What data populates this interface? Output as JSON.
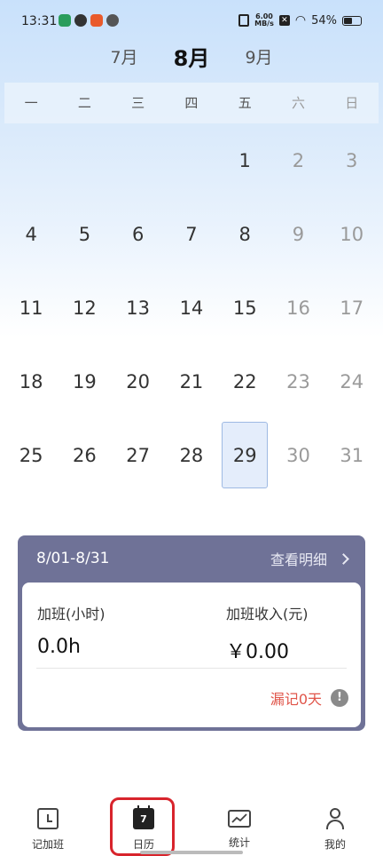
{
  "status_bar": {
    "time": "13:31",
    "net_speed_top": "6.00",
    "net_speed_bottom": "MB/s",
    "battery": "54%",
    "battery_level": 0.54
  },
  "months": {
    "prev": "7月",
    "current": "8月",
    "next": "9月"
  },
  "weekdays": [
    "一",
    "二",
    "三",
    "四",
    "五",
    "六",
    "日"
  ],
  "calendar": {
    "weeks": [
      [
        "",
        "",
        "",
        "",
        "1",
        "2",
        "3"
      ],
      [
        "4",
        "5",
        "6",
        "7",
        "8",
        "9",
        "10"
      ],
      [
        "11",
        "12",
        "13",
        "14",
        "15",
        "16",
        "17"
      ],
      [
        "18",
        "19",
        "20",
        "21",
        "22",
        "23",
        "24"
      ],
      [
        "25",
        "26",
        "27",
        "28",
        "29",
        "30",
        "31"
      ]
    ],
    "selected_day": "29"
  },
  "summary": {
    "range": "8/01-8/31",
    "detail_label": "查看明细",
    "overtime_label": "加班(小时)",
    "overtime_value": "0.0h",
    "income_label": "加班收入(元)",
    "income_value": "￥0.00",
    "missed_label": "漏记0天",
    "info_glyph": "!"
  },
  "nav": {
    "items": [
      {
        "label": "记加班",
        "icon": "record-overtime-icon"
      },
      {
        "label": "日历",
        "icon": "calendar-icon",
        "badge": "7"
      },
      {
        "label": "统计",
        "icon": "stats-icon"
      },
      {
        "label": "我的",
        "icon": "profile-icon"
      }
    ],
    "active_index": 1
  },
  "colors": {
    "summary_header": "#6f7297",
    "missed_text": "#e0554a",
    "highlight": "#d8242c",
    "selected_day_bg": "#e4edfb"
  }
}
